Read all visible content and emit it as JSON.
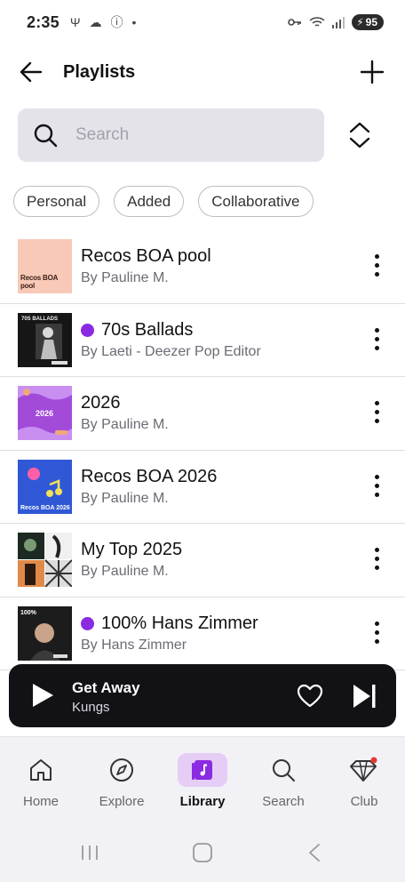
{
  "status_bar": {
    "time": "2:35",
    "battery": "95"
  },
  "header": {
    "title": "Playlists"
  },
  "search": {
    "placeholder": "Search"
  },
  "filters": [
    "Personal",
    "Added",
    "Collaborative"
  ],
  "playlists": [
    {
      "title": "Recos BOA pool",
      "subtitle": "By Pauline M.",
      "verified": false,
      "cover": "peach",
      "cover_text": "Recos BOA pool"
    },
    {
      "title": "70s Ballads",
      "subtitle": "By Laeti - Deezer Pop Editor",
      "verified": true,
      "cover": "dark",
      "cover_text": "70S BALLADS"
    },
    {
      "title": "2026",
      "subtitle": "By Pauline M.",
      "verified": false,
      "cover": "purple",
      "cover_text": "2026"
    },
    {
      "title": "Recos BOA 2026",
      "subtitle": "By Pauline M.",
      "verified": false,
      "cover": "blue",
      "cover_text": "Recos BOA 2026"
    },
    {
      "title": "My Top 2025",
      "subtitle": "By Pauline M.",
      "verified": false,
      "cover": "grid"
    },
    {
      "title": "100% Hans Zimmer",
      "subtitle": "By Hans Zimmer",
      "verified": true,
      "cover": "zimmer",
      "cover_text": "100%"
    }
  ],
  "player": {
    "title": "Get Away",
    "artist": "Kungs"
  },
  "bottom_nav": [
    {
      "label": "Home",
      "icon": "home-icon"
    },
    {
      "label": "Explore",
      "icon": "compass-icon"
    },
    {
      "label": "Library",
      "icon": "library-icon",
      "active": true
    },
    {
      "label": "Search",
      "icon": "search-icon"
    },
    {
      "label": "Club",
      "icon": "diamond-icon"
    }
  ],
  "colors": {
    "accent": "#8a2be2",
    "active_bg": "#e5cdf6",
    "player_bg": "#121216",
    "badge_dot": "#e53935"
  }
}
